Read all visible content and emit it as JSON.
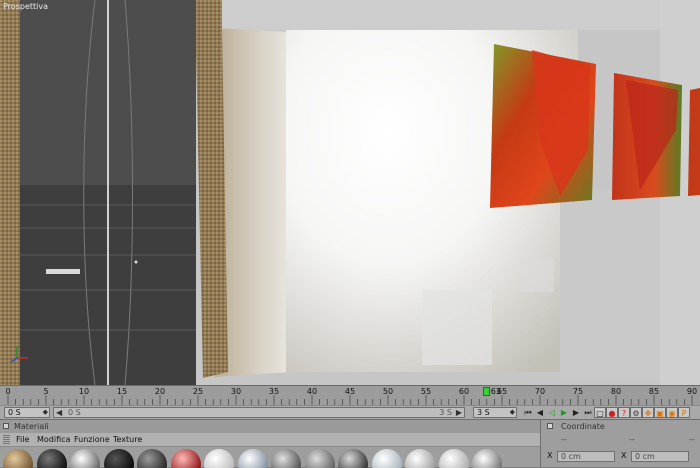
{
  "viewport": {
    "title": "Prospettiva"
  },
  "timeline": {
    "ticks": [
      "0",
      "5",
      "10",
      "15",
      "20",
      "25",
      "30",
      "35",
      "40",
      "45",
      "50",
      "55",
      "60",
      "65",
      "70",
      "75",
      "80",
      "85",
      "90"
    ],
    "current_frame": "63",
    "current_frame_value": 63,
    "max_frame": 90
  },
  "transport": {
    "start_field": "0 S",
    "range_start": "0 S",
    "range_end": "3 S",
    "end_field": "3 S",
    "left_arrow": "◀",
    "right_arrow": "▶",
    "buttons": [
      {
        "name": "goto-start-button",
        "glyph": "⏮",
        "color": "#202020"
      },
      {
        "name": "prev-key-button",
        "glyph": "◀",
        "color": "#202020"
      },
      {
        "name": "prev-frame-button",
        "glyph": "◁",
        "color": "#1f9b1f"
      },
      {
        "name": "play-button",
        "glyph": "▶",
        "color": "#1f9b1f"
      },
      {
        "name": "next-key-button",
        "glyph": "▶",
        "color": "#202020"
      },
      {
        "name": "goto-end-button",
        "glyph": "⏭",
        "color": "#202020"
      },
      {
        "name": "record-toggle-button",
        "glyph": "▢",
        "color": "#202020"
      },
      {
        "name": "record-button",
        "glyph": "●",
        "color": "#d02020"
      },
      {
        "name": "autokey-button",
        "glyph": "?",
        "color": "#d02020"
      },
      {
        "name": "key-settings-button",
        "glyph": "⚙",
        "color": "#404040"
      },
      {
        "name": "move-tool-button",
        "glyph": "✥",
        "color": "#e07000"
      },
      {
        "name": "scale-tool-button",
        "glyph": "▣",
        "color": "#e07000"
      },
      {
        "name": "rotate-tool-button",
        "glyph": "◉",
        "color": "#e07000"
      },
      {
        "name": "param-tool-button",
        "glyph": "P",
        "color": "#e07000"
      }
    ]
  },
  "materials": {
    "title": "Materiali",
    "menu": [
      "File",
      "Modifica",
      "Funzione",
      "Texture"
    ],
    "swatches": [
      {
        "name": "material-swatch-wood",
        "c1": "#e3c79c",
        "c2": "#6a4c2a"
      },
      {
        "name": "material-swatch-black",
        "c1": "#777777",
        "c2": "#080808"
      },
      {
        "name": "material-swatch-silver",
        "c1": "#ffffff",
        "c2": "#5e5e5e"
      },
      {
        "name": "material-swatch-dark",
        "c1": "#555555",
        "c2": "#050505"
      },
      {
        "name": "material-swatch-noise",
        "c1": "#999999",
        "c2": "#202020"
      },
      {
        "name": "material-swatch-red",
        "c1": "#ffb8b8",
        "c2": "#8a0c0c"
      },
      {
        "name": "material-swatch-white",
        "c1": "#ffffff",
        "c2": "#b8b8b8"
      },
      {
        "name": "material-swatch-glass",
        "c1": "#ffffff",
        "c2": "#7a8a9a"
      },
      {
        "name": "material-swatch-stripes",
        "c1": "#e0e0e0",
        "c2": "#4a4a4a"
      },
      {
        "name": "material-swatch-gray",
        "c1": "#dcdcdc",
        "c2": "#5a5a5a"
      },
      {
        "name": "material-swatch-metal",
        "c1": "#d8d8d8",
        "c2": "#2b2b2b"
      },
      {
        "name": "material-swatch-clear",
        "c1": "#ffffff",
        "c2": "#a2b0b8"
      },
      {
        "name": "material-swatch-light",
        "c1": "#ffffff",
        "c2": "#9a9a9a"
      },
      {
        "name": "material-swatch-pale",
        "c1": "#ffffff",
        "c2": "#a8a8a8"
      },
      {
        "name": "material-swatch-chrome",
        "c1": "#ffffff",
        "c2": "#6c6c6c"
      }
    ]
  },
  "coordinates": {
    "title": "Coordinate",
    "dashes": "--",
    "x_label": "X",
    "x_value": "0 cm",
    "x2_label": "X",
    "x2_value": "0 cm"
  },
  "colors": {
    "panel_bg": "#9e9e9e",
    "timeline_playhead": "#38d038",
    "viewport_dark": "#4b4b4b",
    "poppy_red": "#d42a10",
    "leaf_green": "#5d8a26"
  }
}
